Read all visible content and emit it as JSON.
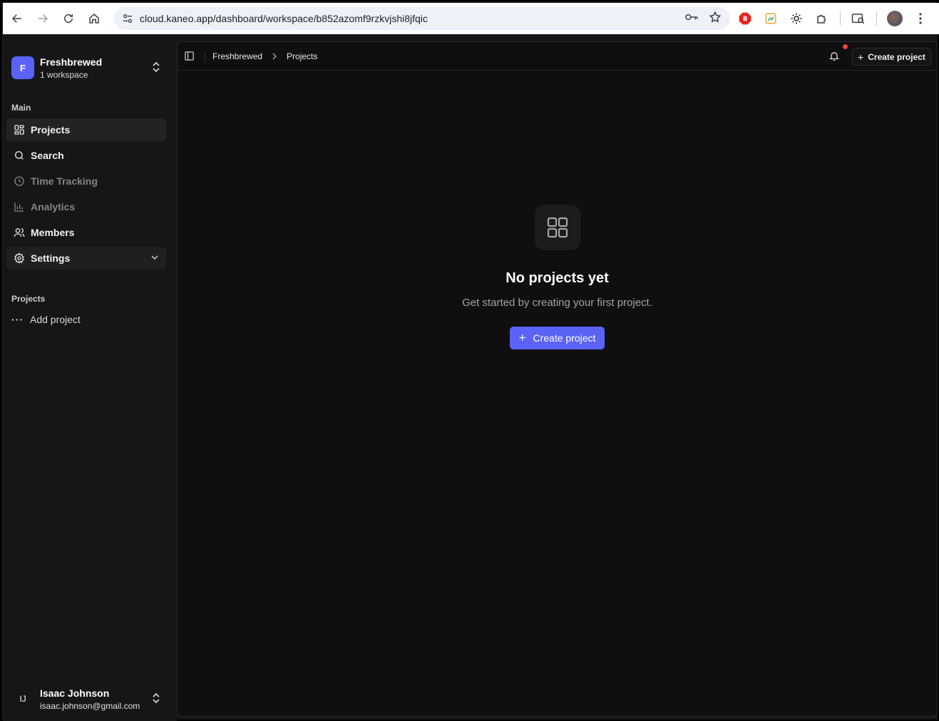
{
  "browser": {
    "url": "cloud.kaneo.app/dashboard/workspace/b852azomf9rzkvjshi8jfqic"
  },
  "workspace": {
    "initial": "F",
    "name": "Freshbrewed",
    "subtitle": "1 workspace"
  },
  "sidebar": {
    "main_label": "Main",
    "items": [
      {
        "label": "Projects",
        "icon": "grid-icon",
        "state": "active"
      },
      {
        "label": "Search",
        "icon": "search-icon",
        "state": "normal"
      },
      {
        "label": "Time Tracking",
        "icon": "clock-icon",
        "state": "disabled"
      },
      {
        "label": "Analytics",
        "icon": "bar-chart-icon",
        "state": "disabled"
      },
      {
        "label": "Members",
        "icon": "users-icon",
        "state": "normal"
      },
      {
        "label": "Settings",
        "icon": "gear-icon",
        "state": "expandable"
      }
    ],
    "projects_label": "Projects",
    "add_project": "Add project"
  },
  "user": {
    "initials": "IJ",
    "name": "Isaac Johnson",
    "email": "isaac.johnson@gmail.com"
  },
  "topbar": {
    "breadcrumb": [
      "Freshbrewed",
      "Projects"
    ],
    "create_label": "Create project",
    "has_notification": true
  },
  "empty_state": {
    "title": "No projects yet",
    "subtitle": "Get started by creating your first project.",
    "cta_label": "Create project"
  },
  "colors": {
    "accent": "#5b63f6",
    "notification": "#ef4444"
  }
}
